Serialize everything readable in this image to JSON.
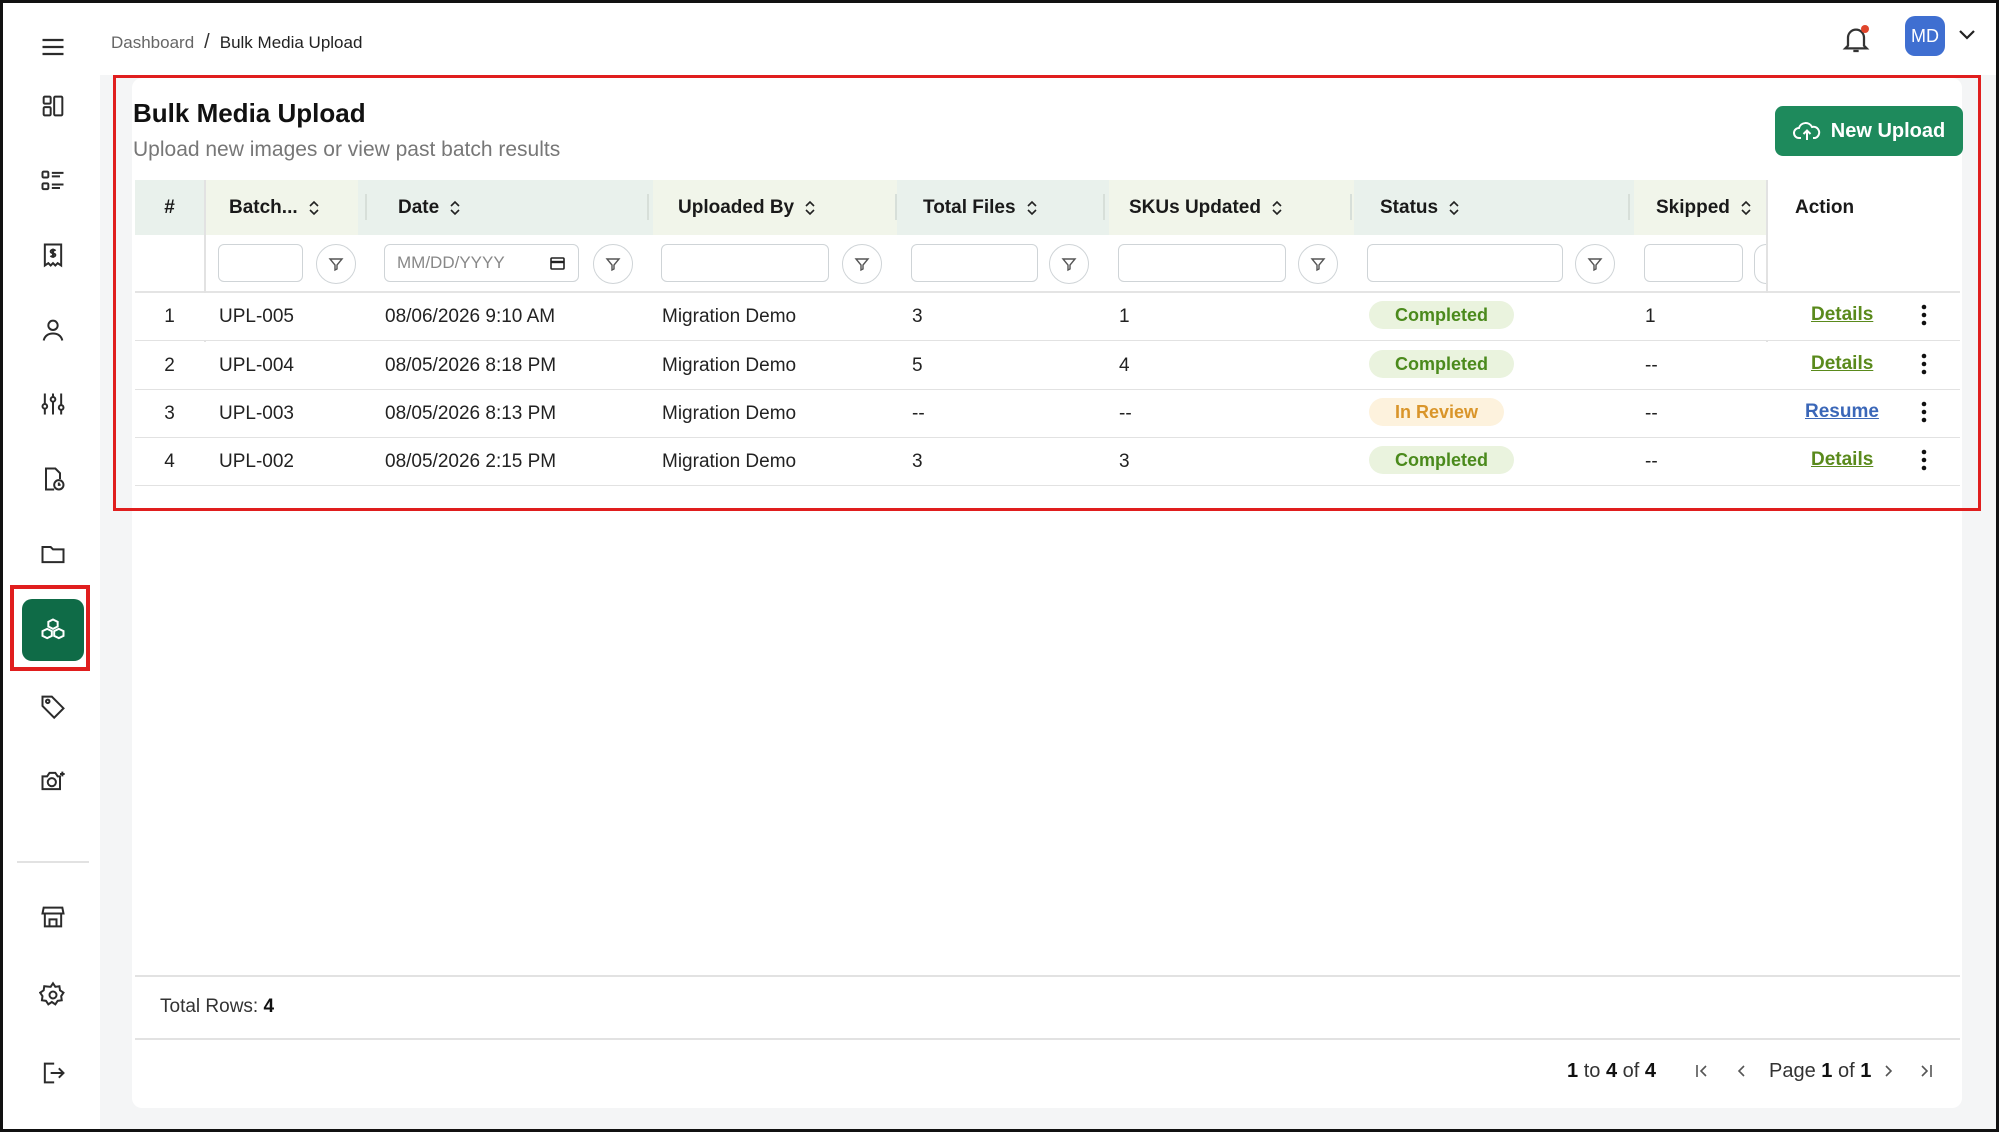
{
  "breadcrumb": {
    "root": "Dashboard",
    "current": "Bulk Media Upload"
  },
  "user": {
    "initials": "MD"
  },
  "page": {
    "title": "Bulk Media Upload",
    "subtitle": "Upload new images or view past batch results",
    "new_upload_label": "New Upload"
  },
  "sidebar": {
    "items": [
      {
        "icon": "dashboard-icon"
      },
      {
        "icon": "list-icon"
      },
      {
        "icon": "invoice-icon"
      },
      {
        "icon": "user-icon"
      },
      {
        "icon": "sliders-icon"
      },
      {
        "icon": "file-clock-icon"
      },
      {
        "icon": "folder-icon"
      },
      {
        "icon": "boxes-icon",
        "active": true
      },
      {
        "icon": "tag-icon"
      },
      {
        "icon": "camera-plus-icon"
      },
      {
        "icon": "store-icon"
      },
      {
        "icon": "settings-icon"
      },
      {
        "icon": "logout-icon"
      }
    ]
  },
  "table": {
    "columns": [
      "#",
      "Batch...",
      "Date",
      "Uploaded By",
      "Total Files",
      "SKUs Updated",
      "Status",
      "Skipped",
      "Action"
    ],
    "date_placeholder": "MM/DD/YYYY",
    "rows": [
      {
        "num": "1",
        "batch": "UPL-005",
        "date": "08/06/2026 9:10 AM",
        "by": "Migration Demo",
        "files": "3",
        "skus": "1",
        "status": "Completed",
        "skipped": "1",
        "action": "Details"
      },
      {
        "num": "2",
        "batch": "UPL-004",
        "date": "08/05/2026 8:18 PM",
        "by": "Migration Demo",
        "files": "5",
        "skus": "4",
        "status": "Completed",
        "skipped": "--",
        "action": "Details"
      },
      {
        "num": "3",
        "batch": "UPL-003",
        "date": "08/05/2026 8:13 PM",
        "by": "Migration Demo",
        "files": "--",
        "skus": "--",
        "status": "In Review",
        "skipped": "--",
        "action": "Resume"
      },
      {
        "num": "4",
        "batch": "UPL-002",
        "date": "08/05/2026 2:15 PM",
        "by": "Migration Demo",
        "files": "3",
        "skus": "3",
        "status": "Completed",
        "skipped": "--",
        "action": "Details"
      }
    ]
  },
  "footer": {
    "total_rows_label": "Total Rows:",
    "total_rows": "4",
    "range_from": "1",
    "range_to_word": "to",
    "range_to": "4",
    "range_of_word": "of",
    "range_total": "4",
    "page_word": "Page",
    "page_current": "1",
    "page_of_word": "of",
    "page_total": "1"
  },
  "colors": {
    "brand": "#1e8a5c",
    "sidebar_active": "#0f6b47",
    "avatar": "#3f6fd1",
    "completed_text": "#4b8a1c",
    "review_text": "#d9952a",
    "highlight": "#e01e1e"
  }
}
